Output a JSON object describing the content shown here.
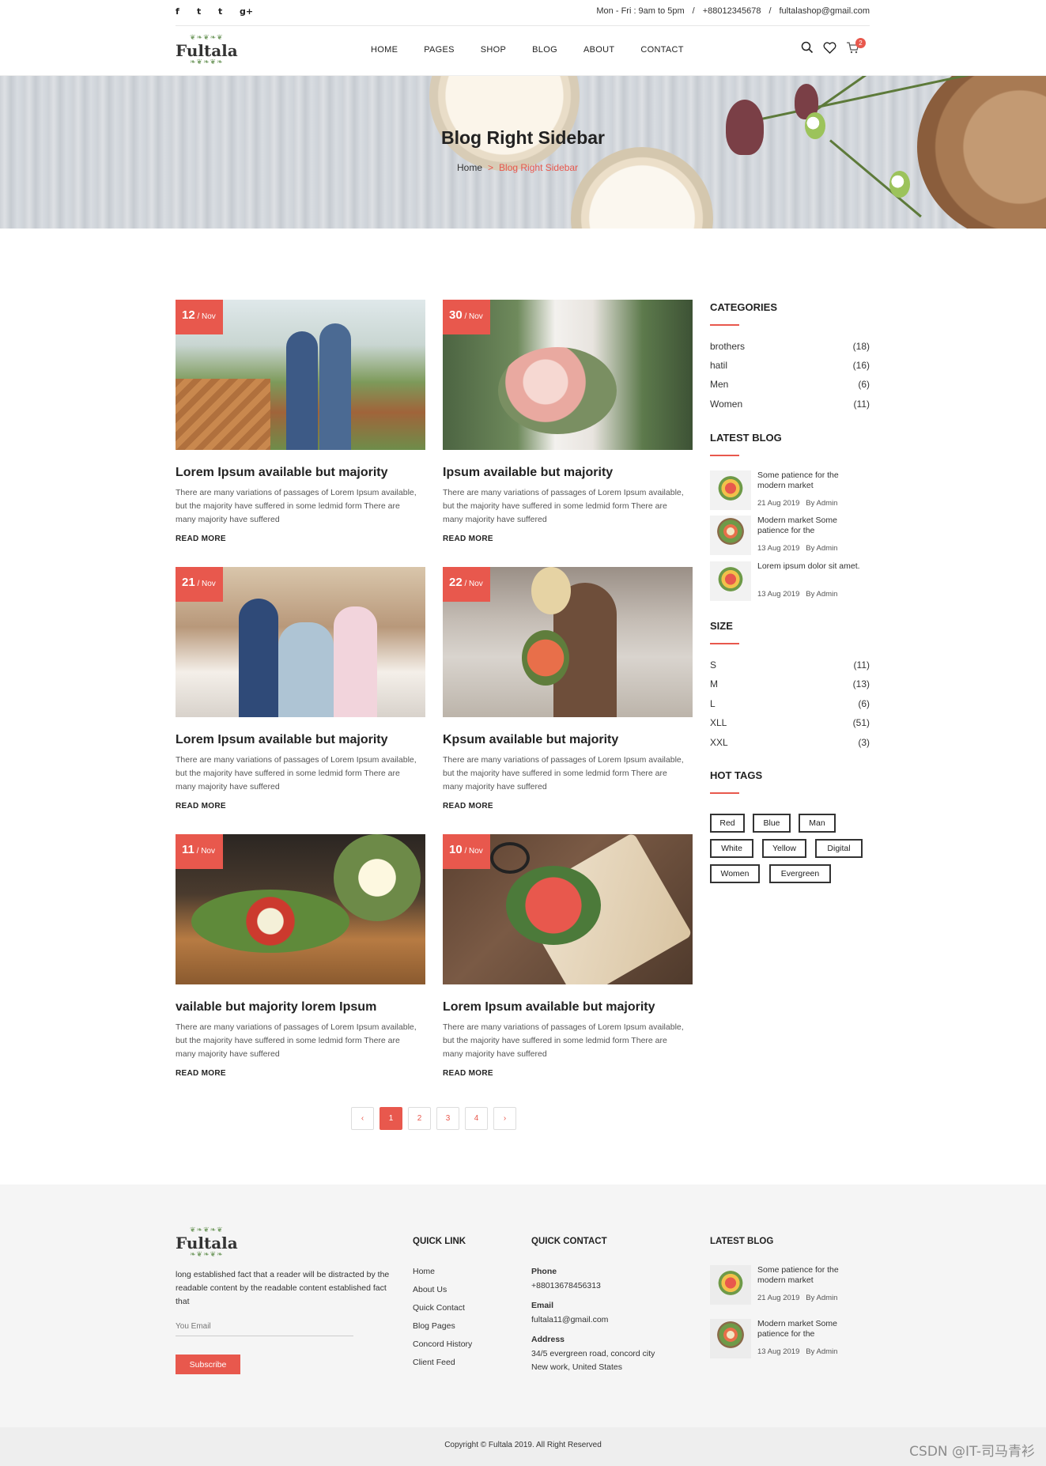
{
  "topbar": {
    "social": [
      "f",
      "t",
      "t",
      "g+"
    ],
    "hours": "Mon - Fri : 9am to 5pm",
    "sep1": "/",
    "phone": "+88012345678",
    "sep2": "/",
    "email": "fultalashop@gmail.com"
  },
  "header": {
    "logo": "Fultala",
    "nav": [
      "HOME",
      "PAGES",
      "SHOP",
      "BLOG",
      "ABOUT",
      "CONTACT"
    ],
    "cart_count": "2"
  },
  "hero": {
    "title": "Blog Right Sidebar",
    "breadcrumb_home": "Home",
    "breadcrumb_sep": ">",
    "breadcrumb_current": "Blog Right Sidebar"
  },
  "posts": [
    {
      "day": "12",
      "month": "/ Nov",
      "title": "Lorem Ipsum available but majority",
      "excerpt": "There are many variations of passages of Lorem Ipsum available, but the majority have suffered in some ledmid form There are many majority have suffered",
      "more": "READ MORE"
    },
    {
      "day": "30",
      "month": "/ Nov",
      "title": "Ipsum available but majority",
      "excerpt": "There are many variations of passages of Lorem Ipsum available, but the majority have suffered in some ledmid form There are many majority have suffered",
      "more": "READ MORE"
    },
    {
      "day": "21",
      "month": "/ Nov",
      "title": "Lorem Ipsum available but majority",
      "excerpt": "There are many variations of passages of Lorem Ipsum available, but the majority have suffered in some ledmid form There are many majority have suffered",
      "more": "READ MORE"
    },
    {
      "day": "22",
      "month": "/ Nov",
      "title": "Kpsum available but majority",
      "excerpt": "There are many variations of passages of Lorem Ipsum available, but the majority have suffered in some ledmid form There are many majority have suffered",
      "more": "READ MORE"
    },
    {
      "day": "11",
      "month": "/ Nov",
      "title": "vailable but majority lorem Ipsum",
      "excerpt": "There are many variations of passages of Lorem Ipsum available, but the majority have suffered in some ledmid form There are many majority have suffered",
      "more": "READ MORE"
    },
    {
      "day": "10",
      "month": "/ Nov",
      "title": "Lorem Ipsum available but majority",
      "excerpt": "There are many variations of passages of Lorem Ipsum available, but the majority have suffered in some ledmid form There are many majority have suffered",
      "more": "READ MORE"
    }
  ],
  "pagination": {
    "prev": "‹",
    "pages": [
      "1",
      "2",
      "3",
      "4"
    ],
    "active": "1",
    "next": "›"
  },
  "sidebar": {
    "categories_title": "CATEGORIES",
    "categories": [
      {
        "name": "brothers",
        "count": "(18)"
      },
      {
        "name": "hatil",
        "count": "(16)"
      },
      {
        "name": "Men",
        "count": "(6)"
      },
      {
        "name": "Women",
        "count": "(11)"
      }
    ],
    "latest_title": "LATEST BLOG",
    "latest": [
      {
        "title": "Some patience for the modern market",
        "date": "21 Aug 2019",
        "author": "By Admin"
      },
      {
        "title": "Modern market Some patience for the",
        "date": "13 Aug 2019",
        "author": "By Admin"
      },
      {
        "title": "Lorem ipsum dolor sit amet.",
        "date": "13 Aug 2019",
        "author": "By Admin"
      }
    ],
    "size_title": "SIZE",
    "sizes": [
      {
        "name": "S",
        "count": "(11)"
      },
      {
        "name": "M",
        "count": "(13)"
      },
      {
        "name": "L",
        "count": "(6)"
      },
      {
        "name": "XLL",
        "count": "(51)"
      },
      {
        "name": "XXL",
        "count": "(3)"
      }
    ],
    "tags_title": "HOT TAGS",
    "tags": [
      "Red",
      "Blue",
      "Man",
      "White",
      "Yellow",
      "Digital",
      "Women",
      "Evergreen"
    ]
  },
  "footer": {
    "logo": "Fultala",
    "about": "long established fact that a reader will be distracted by the readable content by the readable content established fact that",
    "email_placeholder": "You Email",
    "subscribe": "Subscribe",
    "quick_link_title": "QUICK LINK",
    "quick_links": [
      "Home",
      "About Us",
      "Quick Contact",
      "Blog Pages",
      "Concord History",
      "Client Feed"
    ],
    "quick_contact_title": "QUICK CONTACT",
    "phone_label": "Phone",
    "phone": "+88013678456313",
    "email_label": "Email",
    "email": "fultala11@gmail.com",
    "address_label": "Address",
    "address_line1": "34/5 evergreen road, concord city",
    "address_line2": "New work, United States",
    "latest_title": "LATEST BLOG",
    "latest": [
      {
        "title": "Some patience for the modern market",
        "date": "21 Aug 2019",
        "author": "By Admin"
      },
      {
        "title": "Modern market Some patience for the",
        "date": "13 Aug 2019",
        "author": "By Admin"
      }
    ],
    "copyright": "Copyright © Fultala 2019. All Right Reserved"
  },
  "watermark": "CSDN @IT-司马青衫",
  "colors": {
    "accent": "#e8584d"
  }
}
